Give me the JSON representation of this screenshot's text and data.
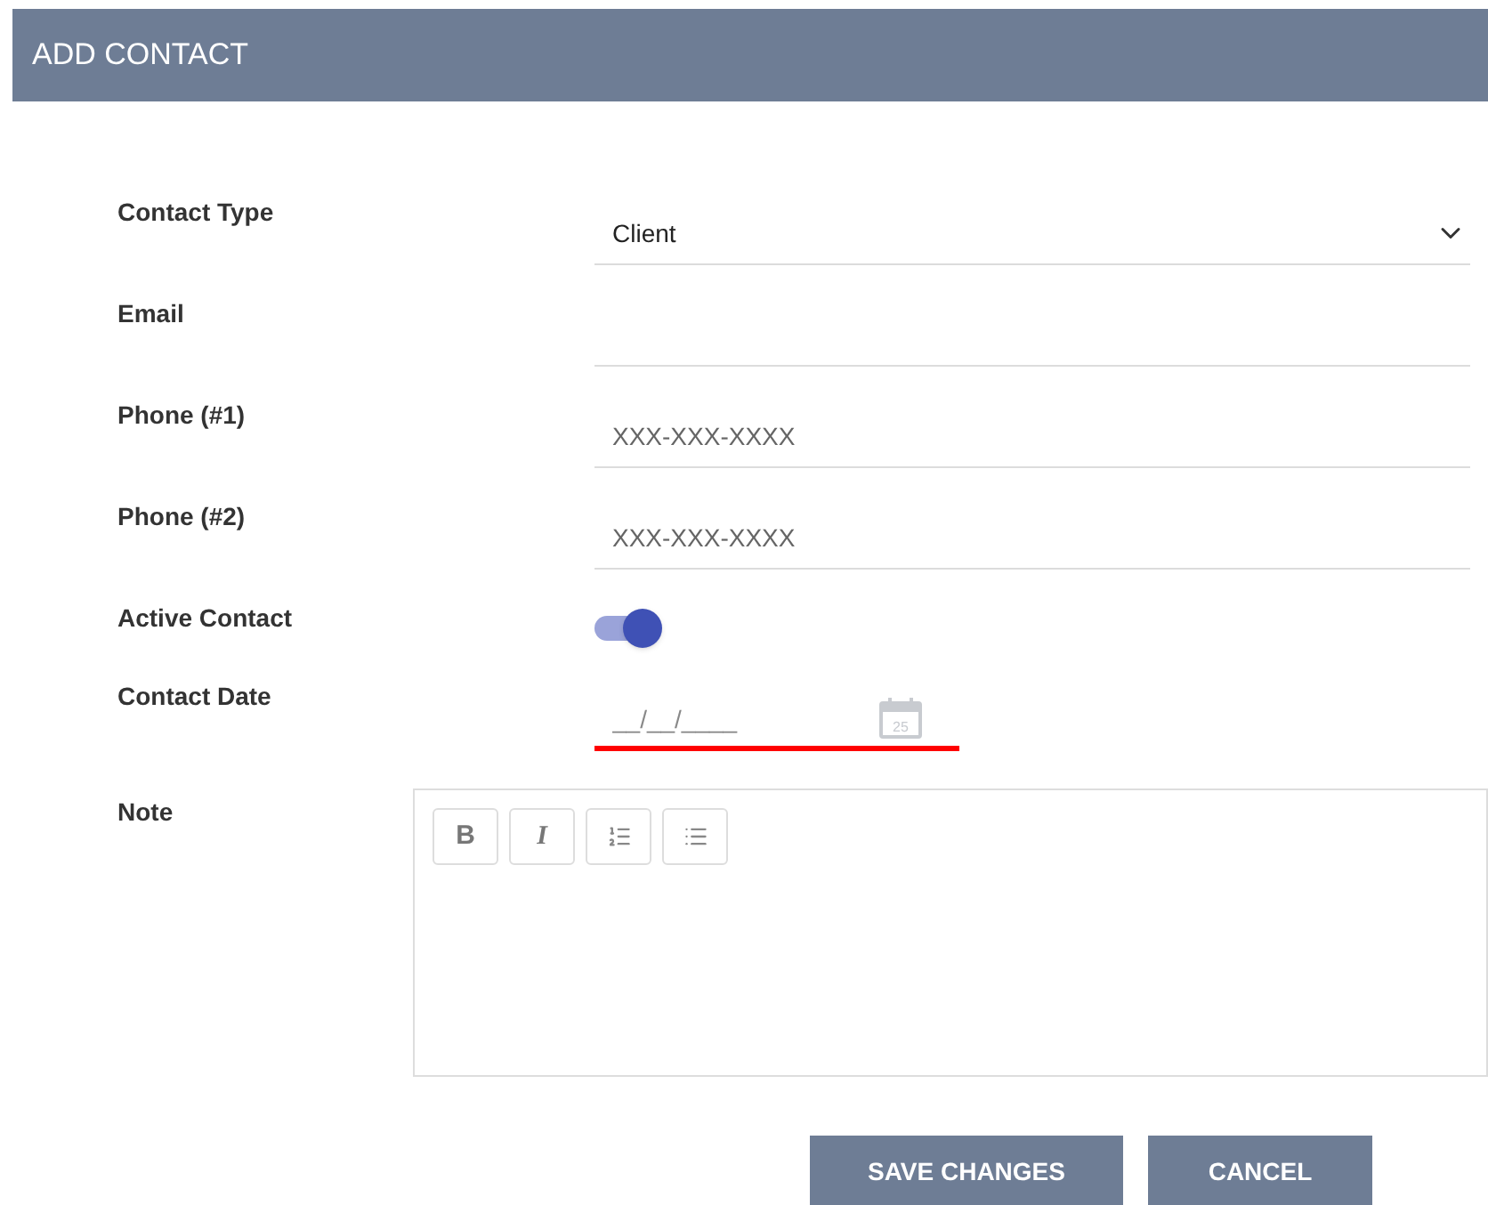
{
  "header": {
    "title": "ADD CONTACT"
  },
  "fields": [
    {
      "kind": "select",
      "label": "Contact Type",
      "value": "Client"
    },
    {
      "kind": "text",
      "label": "Email"
    },
    {
      "kind": "text",
      "label": "Phone (#1)",
      "placeholder": "XXX-XXX-XXXX"
    },
    {
      "kind": "text",
      "label": "Phone (#2)",
      "placeholder": "XXX-XXX-XXXX"
    },
    {
      "kind": "toggle",
      "label": "Active Contact",
      "on": true
    },
    {
      "kind": "date",
      "label": "Contact Date",
      "placeholder": "__/__/____",
      "invalid": true,
      "calendar_day": "25"
    }
  ],
  "note": {
    "label": "Note",
    "toolbar": [
      {
        "kind": "bold",
        "text": "B"
      },
      {
        "kind": "italic",
        "text": "I"
      },
      {
        "kind": "ordered"
      },
      {
        "kind": "bullet"
      }
    ]
  },
  "buttons": [
    "SAVE CHANGES",
    "CANCEL"
  ]
}
